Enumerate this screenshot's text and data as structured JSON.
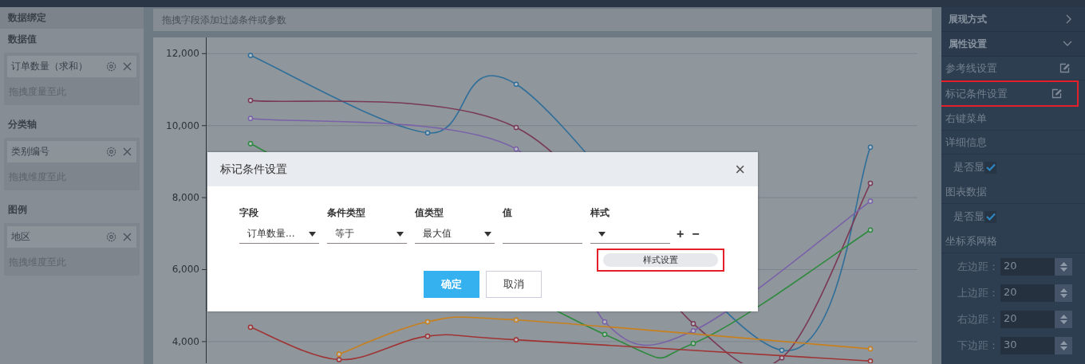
{
  "left_panel": {
    "title": "数据绑定",
    "sections": [
      {
        "title": "数据值",
        "chip": "订单数量（求和）",
        "placeholder": "拖拽度量至此"
      },
      {
        "title": "分类轴",
        "chip": "类别编号",
        "placeholder": "拖拽维度至此"
      },
      {
        "title": "图例",
        "chip": "地区",
        "placeholder": "拖拽维度至此"
      }
    ]
  },
  "filter_bar": {
    "placeholder": "拖拽字段添加过滤条件或参数"
  },
  "chart": {
    "chart_data": {
      "type": "line",
      "grid": true,
      "ylim": [
        3400,
        12450
      ],
      "yticks": [
        {
          "value": 4000,
          "label": "4,000"
        },
        {
          "value": 6000,
          "label": "6,000"
        },
        {
          "value": 8000,
          "label": "8,000"
        },
        {
          "value": 10000,
          "label": "10,000"
        },
        {
          "value": 12000,
          "label": "12,000"
        }
      ],
      "series": [
        {
          "color": "#2f6f9a",
          "marker": true,
          "values": [
            11950,
            null,
            9800,
            11150,
            null,
            null,
            3760,
            9400
          ]
        },
        {
          "color": "#7a3a55",
          "marker": true,
          "values": [
            10700,
            null,
            null,
            9950,
            null,
            4500,
            3550,
            8400
          ]
        },
        {
          "color": "#7a62a8",
          "marker": true,
          "values": [
            10200,
            null,
            null,
            9350,
            4550,
            4300,
            null,
            7900
          ]
        },
        {
          "color": "#2e8a3e",
          "marker": true,
          "values": [
            9500,
            null,
            null,
            null,
            4200,
            3950,
            null,
            7100
          ]
        },
        {
          "color": "#c8801e",
          "marker": true,
          "values": [
            null,
            3650,
            4550,
            4600,
            null,
            null,
            null,
            3800
          ]
        },
        {
          "color": "#a03434",
          "marker": true,
          "values": [
            4400,
            3500,
            4150,
            4050,
            null,
            null,
            null,
            3460
          ]
        }
      ]
    }
  },
  "dialog": {
    "title": "标记条件设置",
    "close": "×",
    "columns": [
      {
        "label": "字段",
        "kind": "select",
        "value": "订单数量..."
      },
      {
        "label": "条件类型",
        "kind": "select",
        "value": "等于"
      },
      {
        "label": "值类型",
        "kind": "select",
        "value": "最大值"
      },
      {
        "label": "值",
        "kind": "input"
      },
      {
        "label": "样式",
        "kind": "select",
        "menu": {
          "option": "样式设置",
          "highlighted": true
        }
      }
    ],
    "add": "+",
    "remove": "−",
    "buttons": [
      {
        "label": "确定",
        "primary": true
      },
      {
        "label": "取消",
        "primary": false
      }
    ]
  },
  "right_panel": {
    "sections": [
      {
        "title": "展现方式",
        "expanded": false
      },
      {
        "title": "属性设置",
        "expanded": true
      }
    ],
    "items": [
      {
        "kind": "edit",
        "label": "参考线设置",
        "highlighted": false
      },
      {
        "kind": "edit",
        "label": "标记条件设置",
        "highlighted": true
      },
      {
        "kind": "heading",
        "label": "右键菜单"
      },
      {
        "kind": "heading",
        "label": "详细信息"
      },
      {
        "kind": "checkbox",
        "label": "是否显",
        "checked": true
      },
      {
        "kind": "heading",
        "label": "图表数据"
      },
      {
        "kind": "checkbox",
        "label": "是否显",
        "checked": true
      },
      {
        "kind": "heading",
        "label": "坐标系网格"
      },
      {
        "kind": "spinner",
        "label": "左边距：",
        "value": "20"
      },
      {
        "kind": "spinner",
        "label": "上边距：",
        "value": "20"
      },
      {
        "kind": "spinner",
        "label": "右边距：",
        "value": "20"
      },
      {
        "kind": "spinner",
        "label": "下边距：",
        "value": "30"
      }
    ]
  }
}
